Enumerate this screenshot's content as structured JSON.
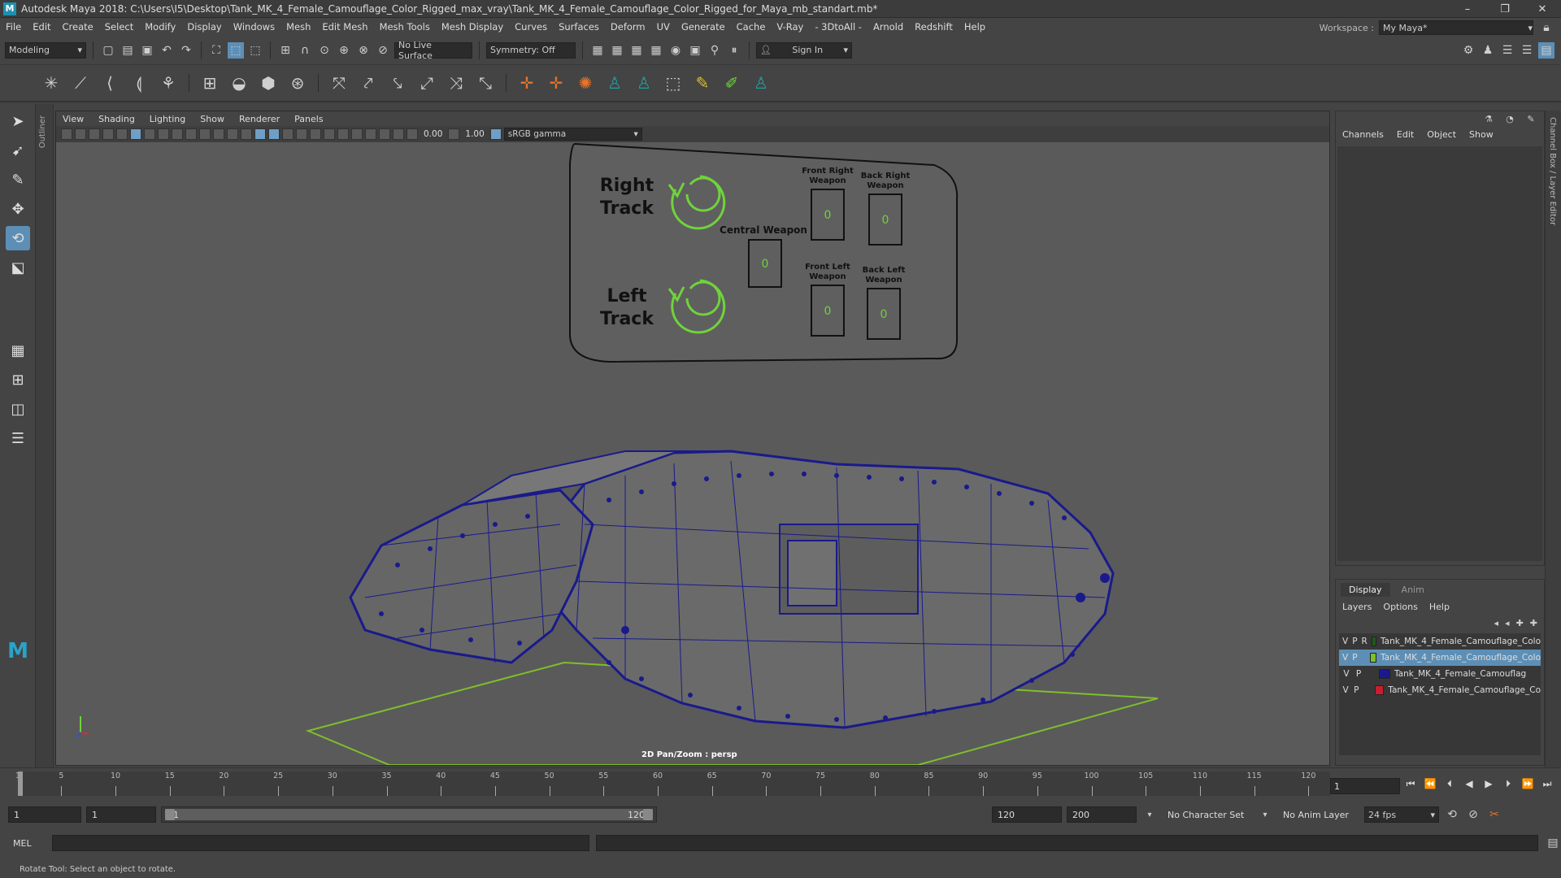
{
  "window": {
    "title": "Autodesk Maya 2018: C:\\Users\\I5\\Desktop\\Tank_MK_4_Female_Camouflage_Color_Rigged_max_vray\\Tank_MK_4_Female_Camouflage_Color_Rigged_for_Maya_mb_standart.mb*",
    "logo": "M",
    "min": "–",
    "max": "❐",
    "close": "✕"
  },
  "menu": [
    "File",
    "Edit",
    "Create",
    "Select",
    "Modify",
    "Display",
    "Windows",
    "Mesh",
    "Edit Mesh",
    "Mesh Tools",
    "Mesh Display",
    "Curves",
    "Surfaces",
    "Deform",
    "UV",
    "Generate",
    "Cache",
    "V-Ray",
    "- 3DtoAll -",
    "Arnold",
    "Redshift",
    "Help"
  ],
  "workspace": {
    "label": "Workspace :",
    "value": "My Maya*"
  },
  "statusline": {
    "mode": "Modeling",
    "live_surface": "No Live Surface",
    "symmetry": "Symmetry: Off",
    "sign_in": "Sign In"
  },
  "viewport": {
    "menu": [
      "View",
      "Shading",
      "Lighting",
      "Show",
      "Renderer",
      "Panels"
    ],
    "exposure": "0.00",
    "gamma_val": "1.00",
    "colorspace": "sRGB gamma",
    "label": "2D Pan/Zoom : persp",
    "controls": {
      "right_track": [
        "Right",
        "Track"
      ],
      "left_track": [
        "Left",
        "Track"
      ],
      "central_weapon": "Central Weapon",
      "front_right_weapon": [
        "Front Right",
        "Weapon"
      ],
      "back_right_weapon": [
        "Back Right",
        "Weapon"
      ],
      "front_left_weapon": [
        "Front Left",
        "Weapon"
      ],
      "back_left_weapon": [
        "Back Left",
        "Weapon"
      ],
      "slider_value": "0"
    },
    "colors": {
      "wire": "#1a1a8c",
      "ground": "#7fbf2a",
      "track_icon": "#6fd33c"
    }
  },
  "channelbox": {
    "menu": [
      "Channels",
      "Edit",
      "Object",
      "Show"
    ],
    "side_label": "Channel Box / Layer Editor"
  },
  "layers": {
    "tabs": [
      "Display",
      "Anim"
    ],
    "menu": [
      "Layers",
      "Options",
      "Help"
    ],
    "rows": [
      {
        "v": "V",
        "p": "P",
        "r": "R",
        "color": "#1e5a1e",
        "name": "Tank_MK_4_Female_Camouflage_Colo"
      },
      {
        "v": "V",
        "p": "P",
        "r": "",
        "color": "#7fbf2a",
        "name": "Tank_MK_4_Female_Camouflage_Colo",
        "selected": true
      },
      {
        "v": "V",
        "p": "P",
        "r": "",
        "color": "#1a1a8c",
        "name": "Tank_MK_4_Female_Camouflag"
      },
      {
        "v": "V",
        "p": "P",
        "r": "",
        "color": "#c81e32",
        "name": "Tank_MK_4_Female_Camouflage_Co"
      }
    ]
  },
  "timeline": {
    "ticks": [
      "1",
      "5",
      "10",
      "15",
      "20",
      "25",
      "30",
      "35",
      "40",
      "45",
      "50",
      "55",
      "60",
      "65",
      "70",
      "75",
      "80",
      "85",
      "90",
      "95",
      "100",
      "105",
      "110",
      "115",
      "120"
    ],
    "current_frame": "1"
  },
  "range": {
    "start": "1",
    "playback_start": "1",
    "inner_start": "1",
    "inner_end": "120",
    "playback_end": "120",
    "end": "200",
    "character_set": "No Character Set",
    "anim_layer": "No Anim Layer",
    "fps": "24 fps"
  },
  "command": {
    "mel": "MEL"
  },
  "help_line": "Rotate Tool: Select an object to rotate."
}
